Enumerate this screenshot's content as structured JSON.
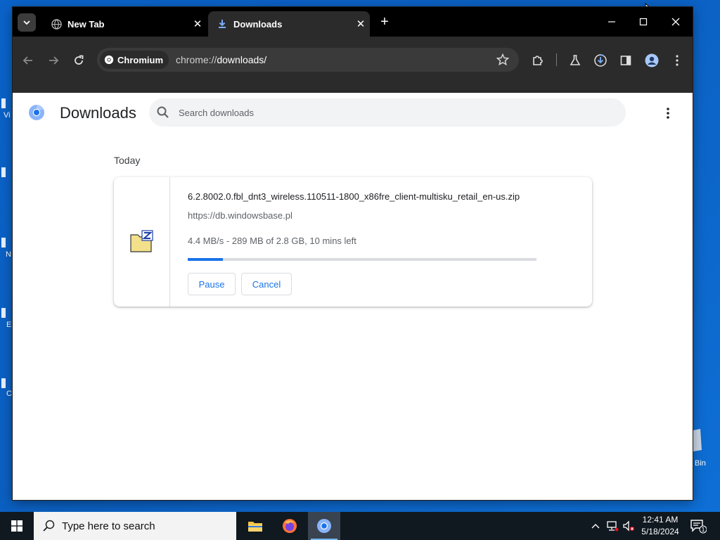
{
  "desktop": {
    "fragments": [
      "Vi",
      "N",
      "E",
      "C",
      "Bin"
    ]
  },
  "browser": {
    "tabs": [
      {
        "title": "New Tab",
        "active": false
      },
      {
        "title": "Downloads",
        "active": true
      }
    ],
    "omnibox": {
      "chip": "Chromium",
      "url_scheme": "chrome://",
      "url_host": "downloads",
      "url_path": "/"
    }
  },
  "page": {
    "title": "Downloads",
    "search_placeholder": "Search downloads",
    "section": "Today",
    "download": {
      "filename": "6.2.8002.0.fbl_dnt3_wireless.110511-1800_x86fre_client-multisku_retail_en-us.zip",
      "source": "https://db.windowsbase.pl",
      "status": "4.4 MB/s - 289 MB of 2.8 GB, 10 mins left",
      "progress_fraction": 0.1,
      "pause_label": "Pause",
      "cancel_label": "Cancel"
    }
  },
  "taskbar": {
    "search_placeholder": "Type here to search",
    "time": "12:41 AM",
    "date": "5/18/2024",
    "notification_count": "1"
  },
  "colors": {
    "accent": "#1a73e8",
    "toolbar": "#2b2b2b",
    "tabstrip": "#000000",
    "desktop": "#0b5fc0"
  }
}
